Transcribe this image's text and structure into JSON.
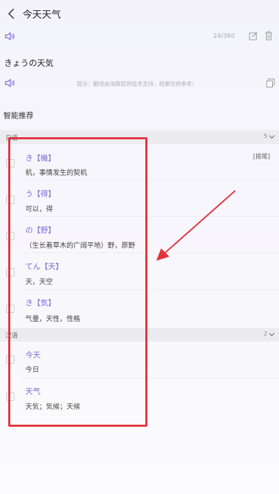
{
  "header": {
    "title": "今天天气"
  },
  "input": {
    "counter": "24/360"
  },
  "result": {
    "text": "きょうの天気",
    "hint": "提示：翻译由海豚提供技术支持，结果仅供参考！"
  },
  "recommend": {
    "title": "智能推荐",
    "sort_label": "[按尾]",
    "groups": [
      {
        "label": "日语",
        "count": "5",
        "items": [
          {
            "word": "き【機】",
            "meaning": "机，事情发生的契机"
          },
          {
            "word": "う【得】",
            "meaning": "可以，得"
          },
          {
            "word": "の【野】",
            "meaning": "（生长着草木的广阔平地）野，原野"
          },
          {
            "word": "てん【天】",
            "meaning": "天，天空"
          },
          {
            "word": "き【気】",
            "meaning": "气量，天性，性格"
          }
        ]
      },
      {
        "label": "汉语",
        "count": "2",
        "items": [
          {
            "word": "今天",
            "meaning": "今日"
          },
          {
            "word": "天气",
            "meaning": "天気；気候；天候"
          }
        ]
      }
    ]
  },
  "colors": {
    "accent": "#7d6bd6",
    "annotation": "#e3333b"
  }
}
